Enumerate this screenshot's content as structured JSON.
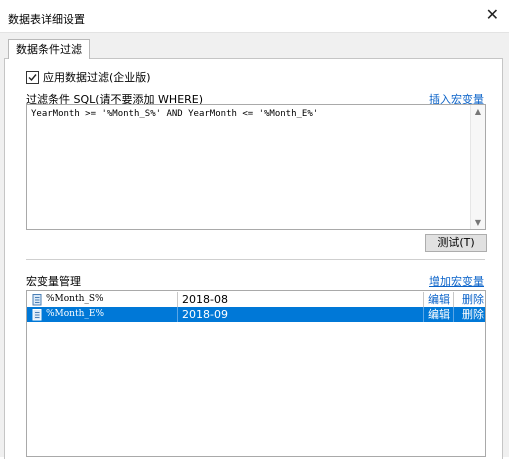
{
  "window": {
    "title": "数据表详细设置",
    "close_glyph": "✕"
  },
  "tabs": [
    {
      "label": "数据条件过滤",
      "active": true
    }
  ],
  "filter": {
    "apply_label": "应用数据过滤(企业版)",
    "apply_checked": true,
    "sql_label": "过滤条件 SQL(请不要添加 WHERE)",
    "insert_macro_link": "插入宏变量",
    "sql_value": "YearMonth >= '%Month_S%' AND YearMonth <= '%Month_E%'",
    "test_button": "测试(T)"
  },
  "macros": {
    "section_label": "宏变量管理",
    "add_link": "增加宏变量",
    "rows": [
      {
        "name": "%Month_S%",
        "value": "2018-08",
        "edit": "编辑",
        "delete": "删除",
        "selected": false
      },
      {
        "name": "%Month_E%",
        "value": "2018-09",
        "edit": "编辑",
        "delete": "删除",
        "selected": true
      }
    ]
  },
  "colors": {
    "selection": "#0078d7",
    "link": "#0b63c9"
  },
  "icons": {
    "check": "checkmark-icon",
    "row": "document-icon",
    "close": "close-icon"
  }
}
